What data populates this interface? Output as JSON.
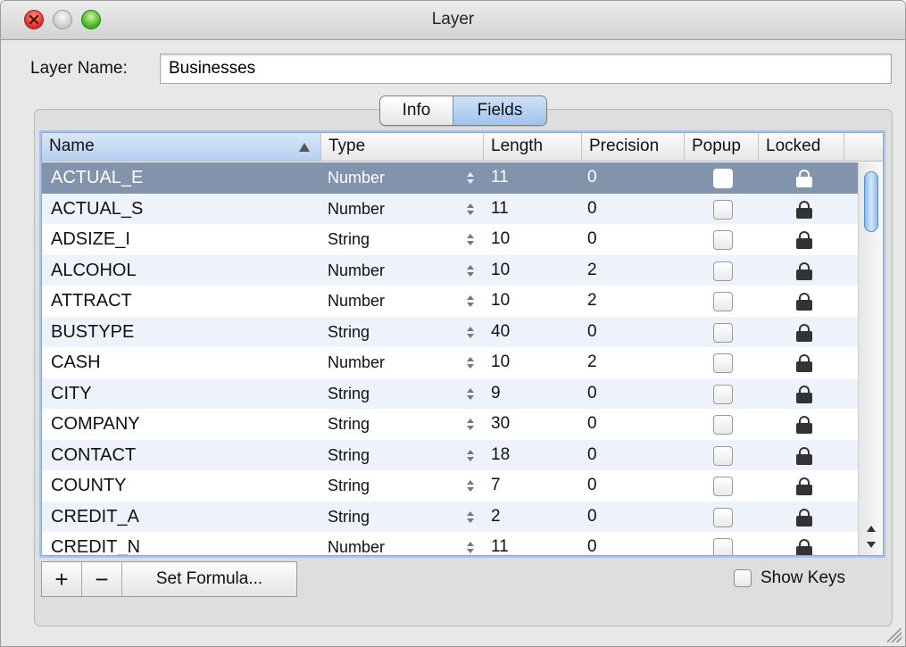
{
  "window": {
    "title": "Layer"
  },
  "layer_name": {
    "label": "Layer Name:",
    "value": "Businesses"
  },
  "tabs": [
    {
      "label": "Info",
      "selected": false
    },
    {
      "label": "Fields",
      "selected": true
    }
  ],
  "table": {
    "columns": [
      "Name",
      "Type",
      "Length",
      "Precision",
      "Popup",
      "Locked"
    ],
    "sort": {
      "column": "Name",
      "direction": "ascending"
    },
    "rows": [
      {
        "name": "ACTUAL_E",
        "type": "Number",
        "length": "11",
        "precision": "0",
        "popup": false,
        "locked": true,
        "selected": true
      },
      {
        "name": "ACTUAL_S",
        "type": "Number",
        "length": "11",
        "precision": "0",
        "popup": false,
        "locked": true
      },
      {
        "name": "ADSIZE_I",
        "type": "String",
        "length": "10",
        "precision": "0",
        "popup": false,
        "locked": true
      },
      {
        "name": "ALCOHOL",
        "type": "Number",
        "length": "10",
        "precision": "2",
        "popup": false,
        "locked": true
      },
      {
        "name": "ATTRACT",
        "type": "Number",
        "length": "10",
        "precision": "2",
        "popup": false,
        "locked": true
      },
      {
        "name": "BUSTYPE",
        "type": "String",
        "length": "40",
        "precision": "0",
        "popup": false,
        "locked": true
      },
      {
        "name": "CASH",
        "type": "Number",
        "length": "10",
        "precision": "2",
        "popup": false,
        "locked": true
      },
      {
        "name": "CITY",
        "type": "String",
        "length": "9",
        "precision": "0",
        "popup": false,
        "locked": true
      },
      {
        "name": "COMPANY",
        "type": "String",
        "length": "30",
        "precision": "0",
        "popup": false,
        "locked": true
      },
      {
        "name": "CONTACT",
        "type": "String",
        "length": "18",
        "precision": "0",
        "popup": false,
        "locked": true
      },
      {
        "name": "COUNTY",
        "type": "String",
        "length": "7",
        "precision": "0",
        "popup": false,
        "locked": true
      },
      {
        "name": "CREDIT_A",
        "type": "String",
        "length": "2",
        "precision": "0",
        "popup": false,
        "locked": true
      },
      {
        "name": "CREDIT_N",
        "type": "Number",
        "length": "11",
        "precision": "0",
        "popup": false,
        "locked": true
      }
    ]
  },
  "bottom": {
    "add_label": "+",
    "remove_label": "−",
    "formula_label": "Set Formula...",
    "show_keys_label": "Show Keys",
    "show_keys_checked": false
  },
  "colors": {
    "selection": "#8293ac",
    "header_sorted": "#b5cfee",
    "segment_selected": "#9ec3ee"
  }
}
